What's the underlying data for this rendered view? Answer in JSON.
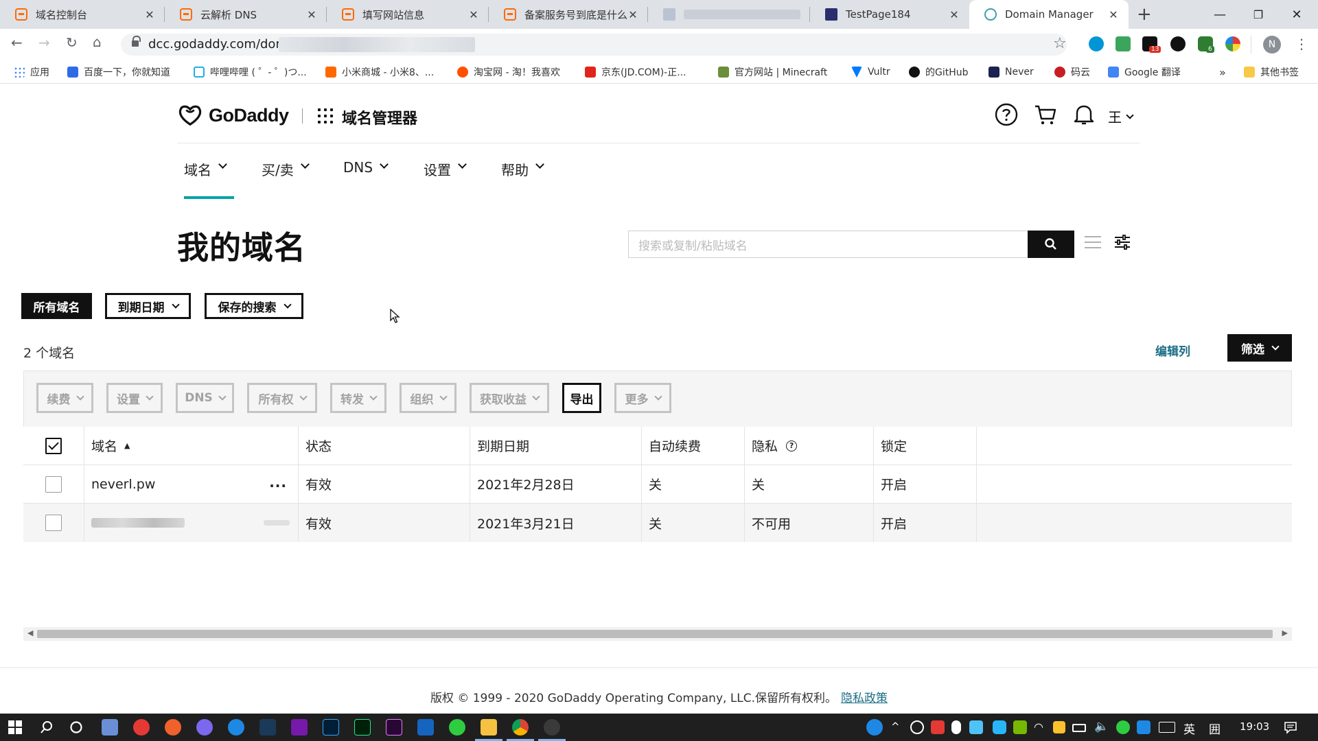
{
  "browser": {
    "tabs": [
      {
        "title": "域名控制台",
        "favicon": "aliyun-icon"
      },
      {
        "title": "云解析 DNS",
        "favicon": "aliyun-icon"
      },
      {
        "title": "填写网站信息",
        "favicon": "aliyun-icon"
      },
      {
        "title": "备案服务号到底是什么",
        "favicon": "aliyun-icon"
      },
      {
        "title": "",
        "favicon": "blurred-icon"
      },
      {
        "title": "TestPage184",
        "favicon": "testpage-icon"
      },
      {
        "title": "Domain Manager",
        "favicon": "godaddy-icon",
        "active": true
      }
    ],
    "url": "dcc.godaddy.com/dom",
    "profile_initial": "N",
    "extension_badges": {
      "first": "13",
      "second": "6"
    },
    "bookmarks": [
      {
        "label": "应用",
        "color": "#4285f4"
      },
      {
        "label": "百度一下，你就知道",
        "color": "#2e6be6"
      },
      {
        "label": "哔哩哔哩 ( ゜- ゜)つ...",
        "color": "#23ade5"
      },
      {
        "label": "小米商城 - 小米8、...",
        "color": "#ff6700"
      },
      {
        "label": "淘宝网 - 淘！我喜欢",
        "color": "#ff5000"
      },
      {
        "label": "京东(JD.COM)-正...",
        "color": "#e1251b"
      },
      {
        "label": "官方网站 | Minecraft",
        "color": "#6b8e3a"
      },
      {
        "label": "Vultr",
        "color": "#007bfc"
      },
      {
        "label": "的GitHub",
        "color": "#111111"
      },
      {
        "label": "Never",
        "color": "#1b2150"
      },
      {
        "label": "码云",
        "color": "#c71d23"
      },
      {
        "label": "Google 翻译",
        "color": "#4285f4"
      }
    ],
    "bookmarks_overflow": "»",
    "other_bookmarks": "其他书签"
  },
  "header": {
    "brand": "GoDaddy",
    "product": "域名管理器",
    "user_initial": "王"
  },
  "nav": [
    {
      "label": "域名",
      "active": true
    },
    {
      "label": "买/卖"
    },
    {
      "label": "DNS"
    },
    {
      "label": "设置"
    },
    {
      "label": "帮助"
    }
  ],
  "page": {
    "title": "我的域名",
    "search_placeholder": "搜索或复制/粘贴域名"
  },
  "filters": {
    "all_domains": "所有域名",
    "expiry_date": "到期日期",
    "saved_searches": "保存的搜索"
  },
  "summary": {
    "count_text": "2 个域名",
    "edit_columns": "编辑列",
    "filter": "筛选"
  },
  "actions": [
    {
      "label": "续费",
      "enabled": false,
      "dropdown": true
    },
    {
      "label": "设置",
      "enabled": false,
      "dropdown": true
    },
    {
      "label": "DNS",
      "enabled": false,
      "dropdown": true
    },
    {
      "label": "所有权",
      "enabled": false,
      "dropdown": true
    },
    {
      "label": "转发",
      "enabled": false,
      "dropdown": true
    },
    {
      "label": "组织",
      "enabled": false,
      "dropdown": true
    },
    {
      "label": "获取收益",
      "enabled": false,
      "dropdown": true
    },
    {
      "label": "导出",
      "enabled": true,
      "dropdown": false
    },
    {
      "label": "更多",
      "enabled": false,
      "dropdown": true
    }
  ],
  "table": {
    "columns": [
      "域名",
      "状态",
      "到期日期",
      "自动续费",
      "隐私",
      "锁定"
    ],
    "rows": [
      {
        "domain": "neverl.pw",
        "status": "有效",
        "expiry": "2021年2月28日",
        "auto_renew": "关",
        "privacy": "关",
        "lock": "开启"
      },
      {
        "domain": "",
        "status": "有效",
        "expiry": "2021年3月21日",
        "auto_renew": "关",
        "privacy": "不可用",
        "lock": "开启"
      }
    ]
  },
  "footer": {
    "copyright": "版权 © 1999 - 2020 GoDaddy Operating Company, LLC.保留所有权利。",
    "privacy_link": "隐私政策"
  },
  "taskbar": {
    "ime": "英",
    "ime_mode": "囲",
    "time": "19:03"
  },
  "colors": {
    "accent_teal": "#00a4a6",
    "link_teal": "#1b6d85",
    "aliyun_orange": "#ff6a00"
  }
}
